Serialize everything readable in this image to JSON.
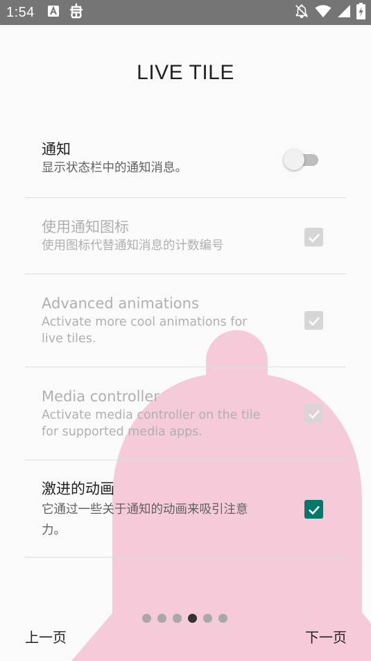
{
  "status_bar": {
    "time": "1:54",
    "notification_icons": [
      "font-download-icon",
      "bug-icon"
    ],
    "system_icons": [
      "notifications-off-icon",
      "wifi-icon",
      "cellular-signal-icon",
      "battery-charging-icon"
    ]
  },
  "header": {
    "title": "LIVE TILE"
  },
  "settings": {
    "items": [
      {
        "title": "通知",
        "summary": "显示状态栏中的通知消息。",
        "control": "switch",
        "checked": false,
        "enabled": true
      },
      {
        "title": "使用通知图标",
        "summary": "使用图标代替通知消息的计数编号",
        "control": "checkbox",
        "checked": true,
        "enabled": false
      },
      {
        "title": "Advanced animations",
        "summary": "Activate more cool animations for live tiles.",
        "control": "checkbox",
        "checked": true,
        "enabled": false
      },
      {
        "title": "Media controller",
        "summary": "Activate media controller on the tile for supported media apps.",
        "control": "checkbox",
        "checked": true,
        "enabled": false
      },
      {
        "title": "激进的动画",
        "summary": "它通过一些关于通知的动画来吸引注意力。",
        "control": "checkbox",
        "checked": true,
        "enabled": true
      }
    ]
  },
  "pager": {
    "total_pages": 6,
    "current_page": 4
  },
  "navigation": {
    "prev_label": "上一页",
    "next_label": "下一页"
  },
  "colors": {
    "status_bar": "#757575",
    "background": "#fafafa",
    "accent": "#00796b",
    "illustration": "#f5cad9",
    "divider": "#dcdcdc"
  }
}
